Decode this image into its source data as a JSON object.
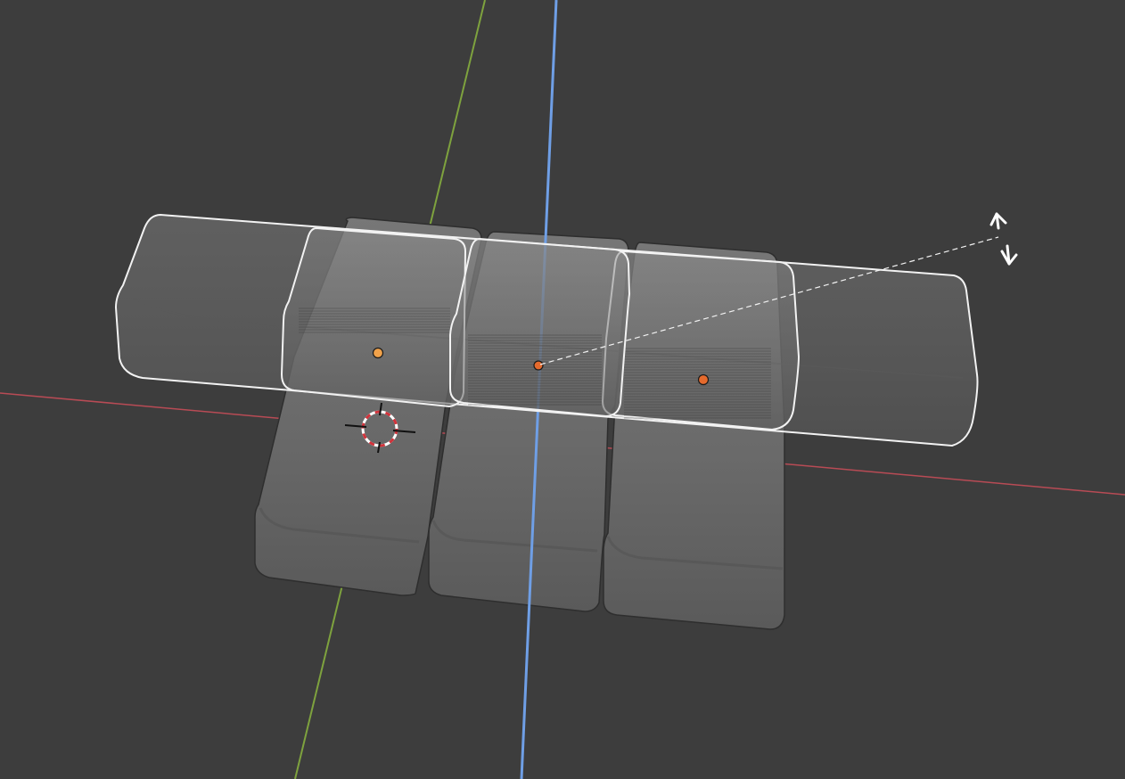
{
  "app": {
    "name": "3D Viewport",
    "mode": "scale-transform"
  },
  "colors": {
    "background": "#3d3d3d",
    "axis_x": "#b84b55",
    "axis_y": "#7ea23e",
    "axis_z": "#6f9fe6",
    "mesh_fill": "#6c6c6c",
    "mesh_edge": "#2e2e2e",
    "selection_outline": "#f2f2f2",
    "origin_active": "#f1a24a",
    "origin_selected": "#e56a2d",
    "cursor_red": "#d1333b",
    "cursor_white": "#ffffff"
  },
  "objects": {
    "lower_row": [
      "cube-back-left",
      "cube-back-middle",
      "cube-back-right"
    ],
    "selected": [
      "bar-long",
      "cube-upper-left",
      "cube-upper-middle",
      "cube-upper-right"
    ]
  },
  "icons": [
    "scale-cursor-icon",
    "3d-cursor-icon",
    "origin-dot-icon"
  ]
}
